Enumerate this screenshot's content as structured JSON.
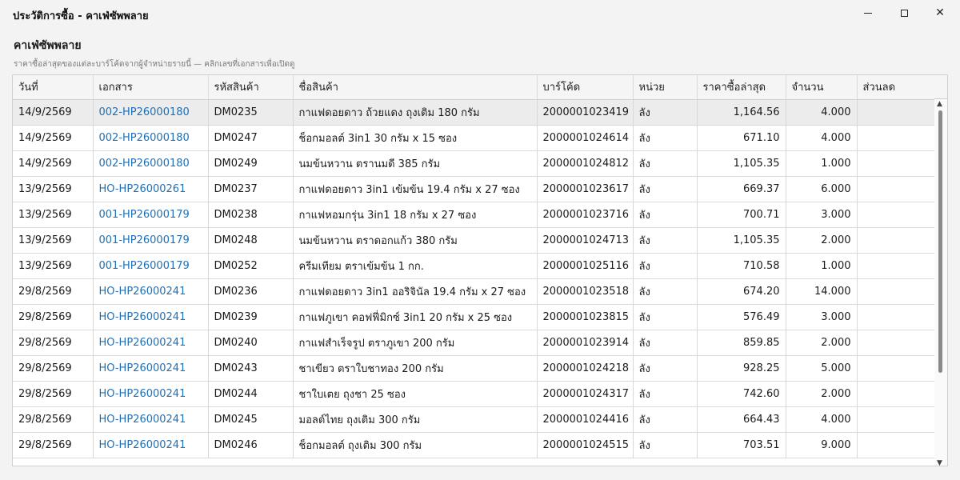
{
  "window": {
    "title": "ประวัติการซื้อ - คาเฟ่ซัพพลาย"
  },
  "header": {
    "title": "คาเฟ่ซัพพลาย",
    "subtitle": "ราคาซื้อล่าสุดของแต่ละบาร์โค้ดจากผู้จำหน่ายรายนี้ — คลิกเลขที่เอกสารเพื่อเปิดดู"
  },
  "table": {
    "columns": [
      "วันที่",
      "เอกสาร",
      "รหัสสินค้า",
      "ชื่อสินค้า",
      "บาร์โค้ด",
      "หน่วย",
      "ราคาซื้อล่าสุด",
      "จำนวน",
      "ส่วนลด"
    ],
    "rows": [
      {
        "date": "14/9/2569",
        "doc": "002-HP26000180",
        "code": "DM0235",
        "name": "กาแฟดอยดาว ถ้วยแดง ถุงเติม 180 กรัม",
        "barcode": "2000001023419",
        "unit": "ลัง",
        "price": "1,164.56",
        "qty": "4.000",
        "discount": ""
      },
      {
        "date": "14/9/2569",
        "doc": "002-HP26000180",
        "code": "DM0247",
        "name": "ช็อกมอลต์ 3in1 30 กรัม x 15 ซอง",
        "barcode": "2000001024614",
        "unit": "ลัง",
        "price": "671.10",
        "qty": "4.000",
        "discount": ""
      },
      {
        "date": "14/9/2569",
        "doc": "002-HP26000180",
        "code": "DM0249",
        "name": "นมข้นหวาน ตรานมดี 385 กรัม",
        "barcode": "2000001024812",
        "unit": "ลัง",
        "price": "1,105.35",
        "qty": "1.000",
        "discount": ""
      },
      {
        "date": "13/9/2569",
        "doc": "HO-HP26000261",
        "code": "DM0237",
        "name": "กาแฟดอยดาว 3in1 เข้มข้น 19.4 กรัม x 27 ซอง",
        "barcode": "2000001023617",
        "unit": "ลัง",
        "price": "669.37",
        "qty": "6.000",
        "discount": ""
      },
      {
        "date": "13/9/2569",
        "doc": "001-HP26000179",
        "code": "DM0238",
        "name": "กาแฟหอมกรุ่น 3in1 18 กรัม x 27 ซอง",
        "barcode": "2000001023716",
        "unit": "ลัง",
        "price": "700.71",
        "qty": "3.000",
        "discount": ""
      },
      {
        "date": "13/9/2569",
        "doc": "001-HP26000179",
        "code": "DM0248",
        "name": "นมข้นหวาน ตราดอกแก้ว 380 กรัม",
        "barcode": "2000001024713",
        "unit": "ลัง",
        "price": "1,105.35",
        "qty": "2.000",
        "discount": ""
      },
      {
        "date": "13/9/2569",
        "doc": "001-HP26000179",
        "code": "DM0252",
        "name": "ครีมเทียม ตราเข้มข้น 1 กก.",
        "barcode": "2000001025116",
        "unit": "ลัง",
        "price": "710.58",
        "qty": "1.000",
        "discount": ""
      },
      {
        "date": "29/8/2569",
        "doc": "HO-HP26000241",
        "code": "DM0236",
        "name": "กาแฟดอยดาว 3in1 ออริจินัล 19.4 กรัม x 27 ซอง",
        "barcode": "2000001023518",
        "unit": "ลัง",
        "price": "674.20",
        "qty": "14.000",
        "discount": ""
      },
      {
        "date": "29/8/2569",
        "doc": "HO-HP26000241",
        "code": "DM0239",
        "name": "กาแฟภูเขา คอฟฟี่มิกซ์ 3in1 20 กรัม x 25 ซอง",
        "barcode": "2000001023815",
        "unit": "ลัง",
        "price": "576.49",
        "qty": "3.000",
        "discount": ""
      },
      {
        "date": "29/8/2569",
        "doc": "HO-HP26000241",
        "code": "DM0240",
        "name": "กาแฟสำเร็จรูป ตราภูเขา 200 กรัม",
        "barcode": "2000001023914",
        "unit": "ลัง",
        "price": "859.85",
        "qty": "2.000",
        "discount": ""
      },
      {
        "date": "29/8/2569",
        "doc": "HO-HP26000241",
        "code": "DM0243",
        "name": "ชาเขียว ตราใบชาทอง 200 กรัม",
        "barcode": "2000001024218",
        "unit": "ลัง",
        "price": "928.25",
        "qty": "5.000",
        "discount": ""
      },
      {
        "date": "29/8/2569",
        "doc": "HO-HP26000241",
        "code": "DM0244",
        "name": "ชาใบเตย ถุงชา 25 ซอง",
        "barcode": "2000001024317",
        "unit": "ลัง",
        "price": "742.60",
        "qty": "2.000",
        "discount": ""
      },
      {
        "date": "29/8/2569",
        "doc": "HO-HP26000241",
        "code": "DM0245",
        "name": "มอลต์ไทย ถุงเติม 300 กรัม",
        "barcode": "2000001024416",
        "unit": "ลัง",
        "price": "664.43",
        "qty": "4.000",
        "discount": ""
      },
      {
        "date": "29/8/2569",
        "doc": "HO-HP26000241",
        "code": "DM0246",
        "name": "ช็อกมอลต์ ถุงเติม 300 กรัม",
        "barcode": "2000001024515",
        "unit": "ลัง",
        "price": "703.51",
        "qty": "9.000",
        "discount": ""
      }
    ]
  },
  "colors": {
    "link": "#1f6fb5",
    "selected_row": "#ececec"
  },
  "icons": {
    "minimize": "minimize-icon",
    "maximize": "maximize-icon",
    "close": "close-icon"
  }
}
